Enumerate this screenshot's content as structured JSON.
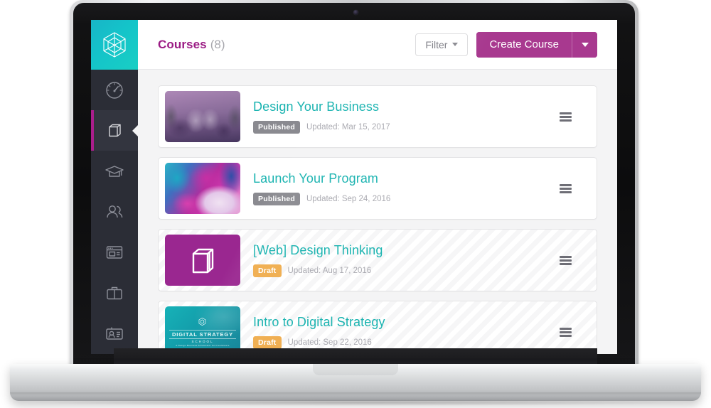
{
  "brand": {
    "accent_magenta": "#a8398f",
    "accent_teal": "#19b3b0",
    "sidebar_bg": "#2b2d36",
    "draft_badge": "#f0ad4e",
    "published_badge": "#8a8a90"
  },
  "sidebar": {
    "logo": {
      "name": "icosahedron-logo"
    },
    "items": [
      {
        "name": "dashboard",
        "icon": "speedometer-icon",
        "active": false
      },
      {
        "name": "courses",
        "icon": "book-icon",
        "active": true
      },
      {
        "name": "students",
        "icon": "graduation-cap-icon",
        "active": false
      },
      {
        "name": "users",
        "icon": "users-icon",
        "active": false
      },
      {
        "name": "pages",
        "icon": "browser-window-icon",
        "active": false
      },
      {
        "name": "products",
        "icon": "briefcase-icon",
        "active": false
      },
      {
        "name": "contacts",
        "icon": "id-badge-icon",
        "active": false
      }
    ]
  },
  "topbar": {
    "title": "Courses",
    "count": "(8)",
    "filter_label": "Filter",
    "create_label": "Create Course"
  },
  "courses": [
    {
      "title": "Design Your Business",
      "status": "Published",
      "status_type": "published",
      "updated": "Updated: Mar 15, 2017",
      "thumb": "workshop-photo"
    },
    {
      "title": "Launch Your Program",
      "status": "Published",
      "status_type": "published",
      "updated": "Updated: Sep 24, 2016",
      "thumb": "abstract-paint"
    },
    {
      "title": "[Web] Design Thinking",
      "status": "Draft",
      "status_type": "draft",
      "updated": "Updated: Aug 17, 2016",
      "thumb": "purple-book-placeholder"
    },
    {
      "title": "Intro to Digital Strategy",
      "status": "Draft",
      "status_type": "draft",
      "updated": "Updated: Sep 22, 2016",
      "thumb": "digital-strategy-school"
    }
  ],
  "thumb_dss": {
    "title": "DIGITAL STRATEGY",
    "sub": "SCHOOL",
    "tag": "A Design Business Accelerator for Freelancers"
  }
}
